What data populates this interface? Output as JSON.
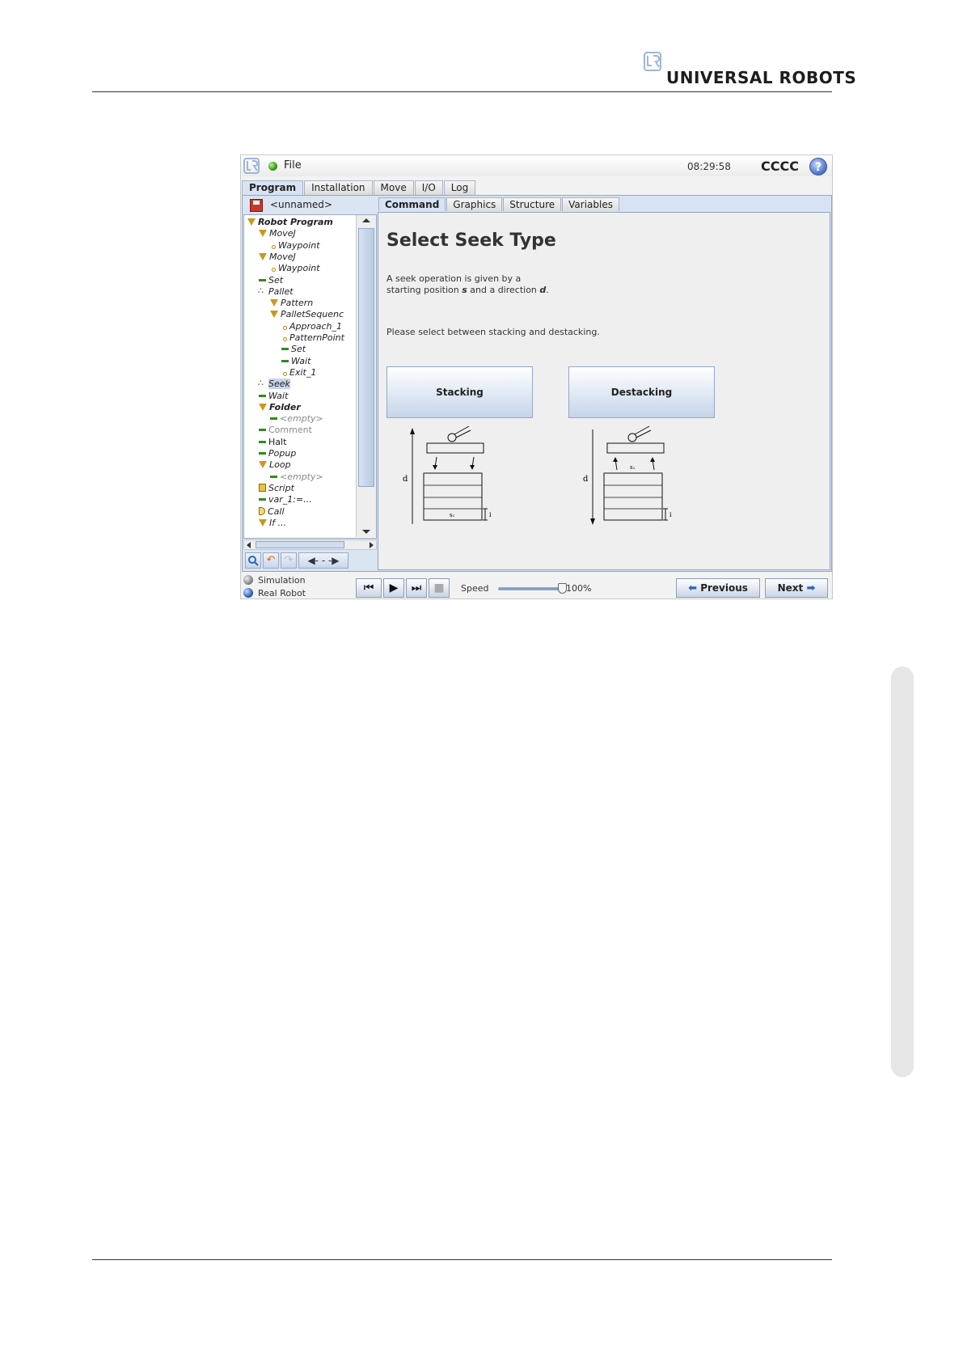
{
  "page": {
    "brand": "UNIVERSAL ROBOTS"
  },
  "app": {
    "file_menu": "File",
    "clock": "08:29:58",
    "robot_name": "CCCC",
    "help": "?",
    "main_tabs": [
      "Program",
      "Installation",
      "Move",
      "I/O",
      "Log"
    ],
    "active_main_tab": "Program",
    "program_name": "<unnamed>",
    "sub_tabs": [
      "Command",
      "Graphics",
      "Structure",
      "Variables"
    ],
    "active_sub_tab": "Command"
  },
  "tree": [
    {
      "label": "Robot Program",
      "icon": "triangle",
      "style": "bold-italic"
    },
    {
      "label": "MoveJ",
      "icon": "triangle",
      "style": "italic"
    },
    {
      "label": "Waypoint",
      "icon": "waypoint-dot",
      "style": "italic"
    },
    {
      "label": "MoveJ",
      "icon": "triangle",
      "style": "italic"
    },
    {
      "label": "Waypoint",
      "icon": "waypoint-dot",
      "style": "italic"
    },
    {
      "label": "Set",
      "icon": "dash",
      "style": "italic"
    },
    {
      "label": "Pallet",
      "icon": "cluster",
      "style": "italic"
    },
    {
      "label": "Pattern",
      "icon": "triangle",
      "style": "italic"
    },
    {
      "label": "PalletSequenc",
      "icon": "triangle",
      "style": "italic"
    },
    {
      "label": "Approach_1",
      "icon": "waypoint-dot",
      "style": "italic"
    },
    {
      "label": "PatternPoint",
      "icon": "waypoint-dot",
      "style": "italic"
    },
    {
      "label": "Set",
      "icon": "dash",
      "style": "italic"
    },
    {
      "label": "Wait",
      "icon": "dash",
      "style": "italic"
    },
    {
      "label": "Exit_1",
      "icon": "waypoint-dot",
      "style": "italic"
    },
    {
      "label": "Seek",
      "icon": "cluster",
      "style": "italic-selected"
    },
    {
      "label": "Wait",
      "icon": "dash",
      "style": "italic"
    },
    {
      "label": "Folder",
      "icon": "triangle",
      "style": "bold-italic"
    },
    {
      "label": "<empty>",
      "icon": "dash",
      "style": "grey-italic"
    },
    {
      "label": "Comment",
      "icon": "dash",
      "style": "grey"
    },
    {
      "label": "Halt",
      "icon": "dash",
      "style": "normal"
    },
    {
      "label": "Popup",
      "icon": "dash",
      "style": "italic"
    },
    {
      "label": "Loop",
      "icon": "triangle",
      "style": "italic"
    },
    {
      "label": "<empty>",
      "icon": "dash",
      "style": "grey-italic"
    },
    {
      "label": "Script",
      "icon": "script",
      "style": "italic"
    },
    {
      "label": "var_1:=...",
      "icon": "dash",
      "style": "italic"
    },
    {
      "label": "Call",
      "icon": "call",
      "style": "italic"
    },
    {
      "label": "If ...",
      "icon": "triangle",
      "style": "italic"
    }
  ],
  "tree_tools": {
    "search": "search-icon",
    "undo": "undo-icon",
    "redo": "redo-icon",
    "move": "◀- - -▶"
  },
  "content": {
    "title": "Select Seek Type",
    "desc_line1": "A seek operation is given by a",
    "desc_line2_pre": "starting position",
    "desc_s": "s",
    "desc_mid": "and a direction",
    "desc_d": "d",
    "desc_end": ".",
    "prompt": "Please select between stacking and destacking.",
    "stacking_label": "Stacking",
    "destacking_label": "Destacking",
    "stack_diagram": {
      "d_label": "d",
      "s_label": "s₁",
      "i_label": "i"
    },
    "destack_diagram": {
      "d_label": "d",
      "s_label": "s₁",
      "i_label": "i"
    }
  },
  "bottom": {
    "simulation": "Simulation",
    "real_robot": "Real Robot",
    "speed_label": "Speed",
    "speed_value": "100%",
    "speed_fraction": 1.0,
    "previous": "Previous",
    "next": "Next"
  },
  "colors": {
    "accent_blue": "#2a64b8",
    "tree_icon_gold": "#c89a1c",
    "status_green": "#2f9a17"
  }
}
